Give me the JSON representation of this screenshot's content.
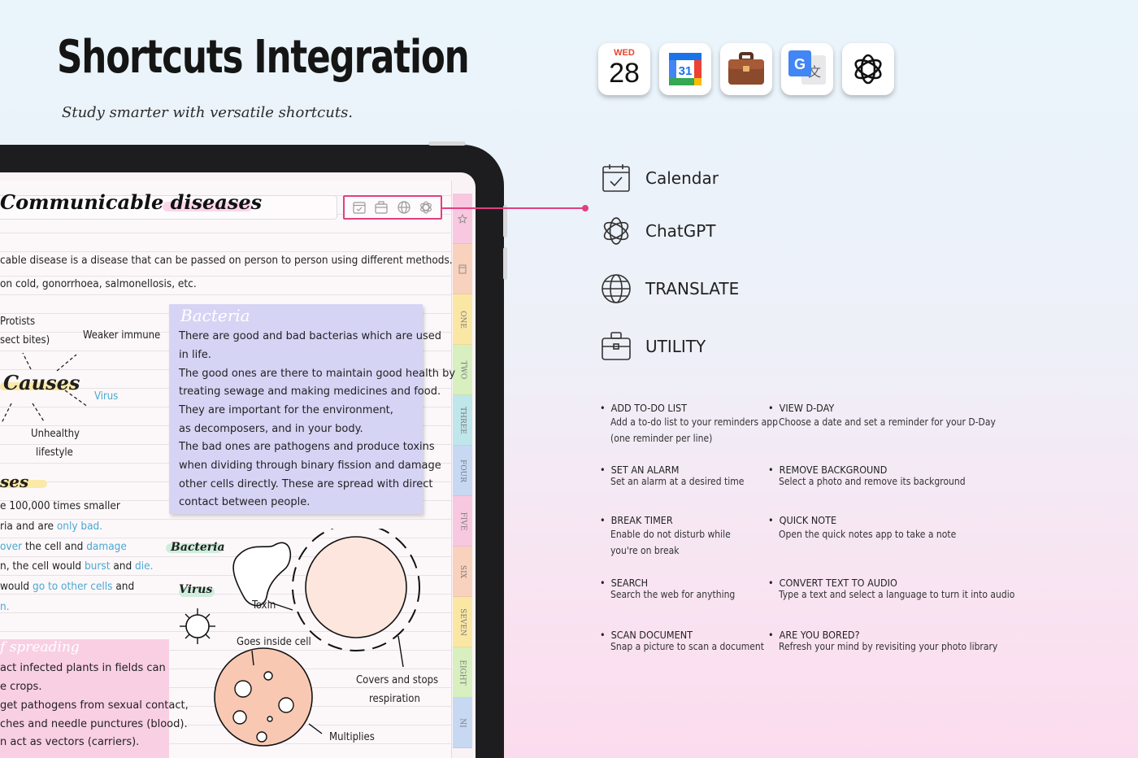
{
  "header": {
    "title": "Shortcuts Integration",
    "subtitle": "Study smarter with versatile shortcuts."
  },
  "app_icons": [
    {
      "name": "calendar-app-icon",
      "day": "WED",
      "date": "28"
    },
    {
      "name": "google-calendar-icon",
      "date": "31"
    },
    {
      "name": "briefcase-icon"
    },
    {
      "name": "google-translate-icon",
      "letter": "G"
    },
    {
      "name": "chatgpt-icon"
    }
  ],
  "notebook": {
    "page_title": "Communicable diseases",
    "lines": [
      "cable disease is a disease that can be passed on person to person using different methods.",
      "on cold, gonorrhoea, salmonellosis, etc."
    ],
    "mindmap": {
      "center": "Causes",
      "nodes": [
        "Protists",
        "sect bites)",
        "Weaker immune",
        "Virus",
        "Unhealthy",
        "lifestyle"
      ]
    },
    "section2": {
      "heading": "ses",
      "lines": [
        [
          "e 100,000 times smaller",
          ""
        ],
        [
          "ria and are ",
          "only bad."
        ],
        [
          "over",
          " the cell and ",
          "damage"
        ],
        [
          "n, the cell would ",
          "burst",
          " and ",
          "die."
        ],
        [
          "would ",
          "go to other cells",
          " and"
        ],
        [
          "n.",
          ""
        ]
      ]
    },
    "bacteria_card": {
      "title": "Bacteria",
      "lines": [
        "There are good and bad bacterias which are used",
        "in life.",
        "The good ones are there to maintain good health by",
        "treating sewage and making medicines and food.",
        "They are important for the environment,",
        "as decomposers, and in your body.",
        "The bad ones are pathogens and produce toxins",
        "when dividing through binary fission and damage",
        "other cells directly. These are spread with direct",
        "contact between people."
      ]
    },
    "diagram": {
      "bacteria_label": "Bacteria",
      "virus_label": "Virus",
      "toxin": "Toxin",
      "goes_inside": "Goes inside cell",
      "covers": "Covers and stops",
      "respiration": "respiration",
      "multiplies": "Multiplies"
    },
    "spread_card": {
      "title": "f spreading",
      "lines": [
        "act infected plants in fields can",
        "e crops.",
        "get pathogens from sexual contact,",
        "ches and needle punctures (blood).",
        "n act as vectors (carriers)."
      ]
    },
    "tabs": [
      "star",
      "calendar",
      "ONE",
      "TWO",
      "THREE",
      "FOUR",
      "FIVE",
      "SIX",
      "SEVEN",
      "EIGHT",
      "NI"
    ],
    "tab_colors": [
      "#f8c8e0",
      "#f9d2bd",
      "#fbe7a4",
      "#d8efc0",
      "#bfe6ea",
      "#c7d8f3",
      "#f8c8e0",
      "#f9d2bd",
      "#fbe7a4",
      "#d8efc0",
      "#c7d8f3"
    ]
  },
  "features": [
    {
      "icon": "calendar-icon",
      "label": "Calendar"
    },
    {
      "icon": "chatgpt-icon",
      "label": "ChatGPT"
    },
    {
      "icon": "globe-icon",
      "label": "TRANSLATE"
    },
    {
      "icon": "briefcase-icon",
      "label": "UTILITY"
    }
  ],
  "shortcuts": [
    {
      "title": "ADD TO-DO LIST",
      "desc": [
        "Add a to-do list to your reminders app",
        "(one reminder per line)"
      ]
    },
    {
      "title": "VIEW D-DAY",
      "desc": [
        "Choose a date and set a reminder for your D-Day"
      ]
    },
    {
      "title": "SET AN ALARM",
      "desc": [
        "Set an alarm at a desired time"
      ]
    },
    {
      "title": "REMOVE BACKGROUND",
      "desc": [
        "Select a photo and remove its background"
      ]
    },
    {
      "title": "BREAK TIMER",
      "desc": [
        "Enable do not disturb while",
        "you're on break"
      ]
    },
    {
      "title": "QUICK NOTE",
      "desc": [
        "Open the quick notes app to take a note"
      ]
    },
    {
      "title": "SEARCH",
      "desc": [
        "Search the web for anything"
      ]
    },
    {
      "title": "CONVERT TEXT TO AUDIO",
      "desc": [
        "Type a text and select a language to turn it into audio"
      ]
    },
    {
      "title": "SCAN DOCUMENT",
      "desc": [
        "Snap a picture to scan a document"
      ]
    },
    {
      "title": "ARE YOU BORED?",
      "desc": [
        "Refresh your mind by revisiting your photo library"
      ]
    }
  ]
}
